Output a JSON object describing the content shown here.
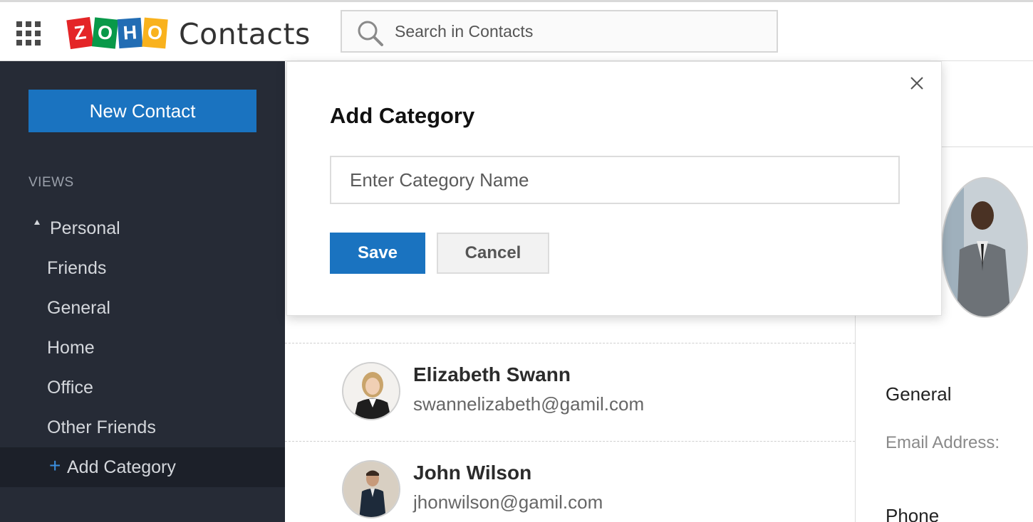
{
  "header": {
    "apps_icon": "grid-icon",
    "logo_letters": [
      "Z",
      "O",
      "H",
      "O"
    ],
    "app_title": "Contacts",
    "search": {
      "placeholder": "Search in Contacts",
      "value": ""
    }
  },
  "sidebar": {
    "new_contact_label": "New Contact",
    "views_heading": "VIEWS",
    "parent": {
      "label": "Personal",
      "expanded": true
    },
    "items": [
      {
        "label": "Friends"
      },
      {
        "label": "General"
      },
      {
        "label": "Home"
      },
      {
        "label": "Office"
      },
      {
        "label": "Other Friends"
      }
    ],
    "add_category": {
      "icon": "+",
      "label": "Add Category"
    }
  },
  "contacts": [
    {
      "name": "Elizabeth Swann",
      "email": "swannelizabeth@gamil.com"
    },
    {
      "name": "John Wilson",
      "email": "jhonwilson@gamil.com"
    }
  ],
  "detail": {
    "section": "General",
    "email_label": "Email Address:",
    "phone_label": "Phone"
  },
  "modal": {
    "title": "Add Category",
    "input_placeholder": "Enter Category Name",
    "input_value": "",
    "save_label": "Save",
    "cancel_label": "Cancel"
  },
  "colors": {
    "accent": "#1a73c0",
    "sidebar_bg": "#262b36",
    "sidebar_active": "#1c2029"
  }
}
